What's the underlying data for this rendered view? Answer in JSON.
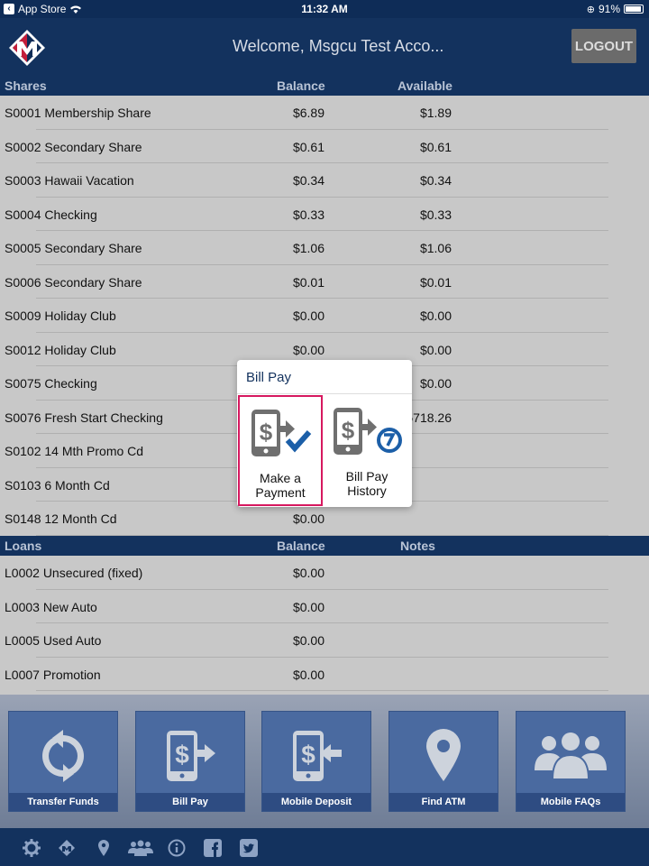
{
  "status_bar": {
    "back_app": "App Store",
    "time": "11:32 AM",
    "battery": "91%"
  },
  "header": {
    "welcome": "Welcome, Msgcu Test Acco...",
    "logout_label": "LOGOUT"
  },
  "shares": {
    "headers": {
      "name": "Shares",
      "balance": "Balance",
      "available": "Available"
    },
    "rows": [
      {
        "name": "S0001 Membership Share",
        "balance": "$6.89",
        "available": "$1.89"
      },
      {
        "name": "S0002 Secondary Share",
        "balance": "$0.61",
        "available": "$0.61"
      },
      {
        "name": "S0003 Hawaii Vacation",
        "balance": "$0.34",
        "available": "$0.34"
      },
      {
        "name": "S0004 Checking",
        "balance": "$0.33",
        "available": "$0.33"
      },
      {
        "name": "S0005 Secondary Share",
        "balance": "$1.06",
        "available": "$1.06"
      },
      {
        "name": "S0006 Secondary Share",
        "balance": "$0.01",
        "available": "$0.01"
      },
      {
        "name": "S0009 Holiday Club",
        "balance": "$0.00",
        "available": "$0.00"
      },
      {
        "name": "S0012 Holiday Club",
        "balance": "$0.00",
        "available": "$0.00"
      },
      {
        "name": "S0075 Checking",
        "balance": "",
        "available": "$0.00"
      },
      {
        "name": "S0076 Fresh Start Checking",
        "balance": "",
        "available": "5718.26"
      },
      {
        "name": "S0102 14 Mth Promo Cd",
        "balance": "",
        "available": ""
      },
      {
        "name": "S0103 6 Month Cd",
        "balance": "",
        "available": ""
      },
      {
        "name": "S0148 12 Month Cd",
        "balance": "$0.00",
        "available": ""
      }
    ]
  },
  "loans": {
    "headers": {
      "name": "Loans",
      "balance": "Balance",
      "notes": "Notes"
    },
    "rows": [
      {
        "name": "L0002 Unsecured (fixed)",
        "balance": "$0.00"
      },
      {
        "name": "L0003 New Auto",
        "balance": "$0.00"
      },
      {
        "name": "L0005 Used Auto",
        "balance": "$0.00"
      },
      {
        "name": "L0007 Promotion",
        "balance": "$0.00"
      }
    ]
  },
  "tiles": [
    {
      "label": "Transfer Funds",
      "icon": "refresh-icon"
    },
    {
      "label": "Bill Pay",
      "icon": "bill-pay-icon"
    },
    {
      "label": "Mobile Deposit",
      "icon": "mobile-deposit-icon"
    },
    {
      "label": "Find ATM",
      "icon": "location-pin-icon"
    },
    {
      "label": "Mobile FAQs",
      "icon": "people-icon"
    }
  ],
  "footer_icons": [
    "gear-icon",
    "logo-icon",
    "location-pin-icon",
    "people-icon",
    "info-icon",
    "facebook-icon",
    "twitter-icon"
  ],
  "popup": {
    "title": "Bill Pay",
    "options": [
      {
        "line1": "Make a",
        "line2": "Payment",
        "icon": "make-payment-icon"
      },
      {
        "line1": "Bill Pay",
        "line2": "History",
        "icon": "bill-pay-history-icon"
      }
    ]
  },
  "colors": {
    "navy": "#13325e",
    "tile": "#4a6aa0",
    "highlight": "#d6185f",
    "check": "#1c5fa8"
  }
}
